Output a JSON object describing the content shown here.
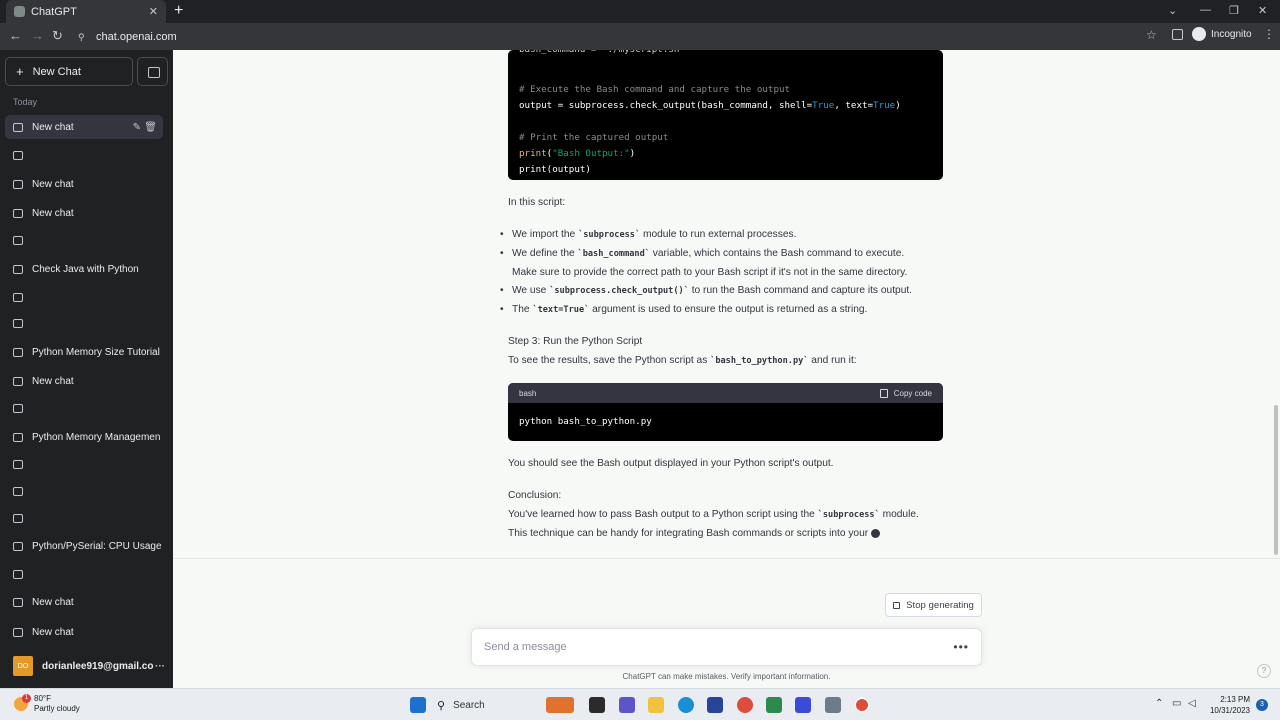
{
  "browser": {
    "tab_title": "ChatGPT",
    "url": "chat.openai.com",
    "profile_label": "Incognito"
  },
  "sidebar": {
    "new_chat_label": "New Chat",
    "section_today": "Today",
    "conversations": [
      {
        "label": "New chat",
        "active": true
      },
      {
        "label": ""
      },
      {
        "label": "New chat"
      },
      {
        "label": "New chat"
      },
      {
        "label": ""
      },
      {
        "label": "Check Java with Python"
      },
      {
        "label": ""
      },
      {
        "label": ""
      },
      {
        "label": "Python Memory Size Tutorial"
      },
      {
        "label": "New chat"
      },
      {
        "label": ""
      },
      {
        "label": "Python Memory Managemen"
      },
      {
        "label": ""
      },
      {
        "label": ""
      },
      {
        "label": ""
      },
      {
        "label": "Python/PySerial: CPU Usage"
      },
      {
        "label": ""
      },
      {
        "label": "New chat"
      },
      {
        "label": "New chat"
      }
    ],
    "user": {
      "initials": "DO",
      "email": "dorianlee919@gmail.co"
    }
  },
  "chat": {
    "code1": {
      "line_top": "bash_command = \"./myscript.sh\"",
      "comment1": "# Execute the Bash command and capture the output",
      "line_output_a": "output = subprocess.check_output(bash_command, shell=",
      "kw_true1": "True",
      "line_output_b": ", text=",
      "kw_true2": "True",
      "line_output_c": ")",
      "comment2": "# Print the captured output",
      "print_fn": "print",
      "print_str": "\"Bash Output:\"",
      "print2": "print(output)"
    },
    "intro": "In this script:",
    "bullets": {
      "b1_pre": "We import the ",
      "b1_code": "`subprocess`",
      "b1_post": " module to run external processes.",
      "b2_pre": "We define the ",
      "b2_code": "`bash_command`",
      "b2_post": " variable, which contains the Bash command to execute.",
      "b2_line2": "Make sure to provide the correct path to your Bash script if it's not in the same directory.",
      "b3_pre": "We use ",
      "b3_code": "`subprocess.check_output()`",
      "b3_post": " to run the Bash command and capture its output.",
      "b4_pre": "The ",
      "b4_code": "`text=True`",
      "b4_post": " argument is used to ensure the output is returned as a string."
    },
    "step3_title": "Step 3: Run the Python Script",
    "step3_pre": "To see the results, save the Python script as ",
    "step3_code": "`bash_to_python.py`",
    "step3_post": " and run it:",
    "code2": {
      "lang": "bash",
      "copy_label": "Copy code",
      "code": "python bash_to_python.py"
    },
    "result_text": "You should see the Bash output displayed in your Python script's output.",
    "conclusion_title": "Conclusion:",
    "conclusion_pre": "You've learned how to pass Bash output to a Python script using the ",
    "conclusion_code": "`subprocess`",
    "conclusion_post": " module.",
    "conclusion_line2": "This technique can be handy for integrating Bash commands or scripts into your"
  },
  "composer": {
    "stop_label": "Stop generating",
    "placeholder": "Send a message",
    "disclaimer": "ChatGPT can make mistakes. Verify important information.",
    "help": "?"
  },
  "taskbar": {
    "weather_badge": "1",
    "temp": "80°F",
    "condition": "Partly cloudy",
    "search_label": "Search",
    "time": "2:13 PM",
    "date": "10/31/2023",
    "notifications": "3"
  }
}
